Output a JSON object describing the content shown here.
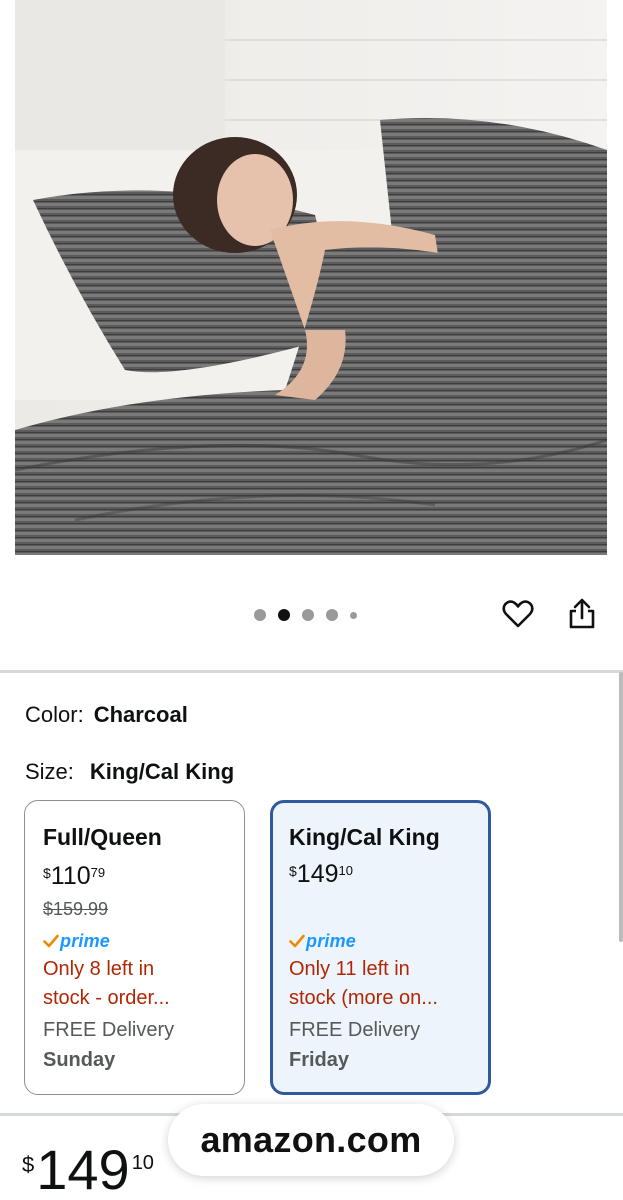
{
  "carousel": {
    "dot_count": 5,
    "active_index": 1
  },
  "product": {
    "color_label": "Color:",
    "color_value": "Charcoal",
    "size_label": "Size:",
    "size_value": "King/Cal King"
  },
  "size_options": [
    {
      "title": "Full/Queen",
      "price_currency": "$",
      "price_whole": "110",
      "price_fraction": "79",
      "list_price": "$159.99",
      "prime_label": "prime",
      "stock_line1": "Only 8 left in",
      "stock_line2": "stock - order...",
      "delivery_label": "FREE Delivery",
      "delivery_day": "Sunday",
      "selected": false
    },
    {
      "title": "King/Cal King",
      "price_currency": "$",
      "price_whole": "149",
      "price_fraction": "10",
      "prime_label": "prime",
      "stock_line1": "Only 11 left in",
      "stock_line2": "stock (more on...",
      "delivery_label": "FREE Delivery",
      "delivery_day": "Friday",
      "selected": true
    }
  ],
  "buybox": {
    "price_currency": "$",
    "price_whole": "149",
    "price_fraction": "10"
  },
  "watermark": {
    "text": "amazon.com"
  },
  "colors": {
    "prime_blue": "#1a98ff",
    "stock_red": "#b12704",
    "selected_border": "#2f5a9e",
    "selected_bg": "#edf4fb"
  },
  "icons": {
    "wishlist": "heart-icon",
    "share": "share-icon",
    "prime": "check-icon"
  }
}
